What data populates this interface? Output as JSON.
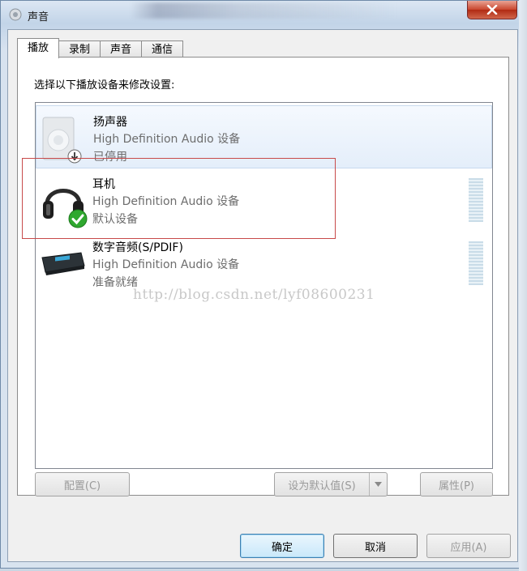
{
  "window": {
    "title": "声音"
  },
  "tabs": [
    {
      "label": "播放",
      "active": true
    },
    {
      "label": "录制",
      "active": false
    },
    {
      "label": "声音",
      "active": false
    },
    {
      "label": "通信",
      "active": false
    }
  ],
  "playback": {
    "instruction": "选择以下播放设备来修改设置:",
    "devices": [
      {
        "name": "扬声器",
        "desc": "High Definition Audio 设备",
        "status": "已停用",
        "icon": "speaker-icon",
        "badge": "disabled-arrow-icon"
      },
      {
        "name": "耳机",
        "desc": "High Definition Audio 设备",
        "status": "默认设备",
        "icon": "headphones-icon",
        "badge": "default-check-icon"
      },
      {
        "name": "数字音频(S/PDIF)",
        "desc": "High Definition Audio 设备",
        "status": "准备就绪",
        "icon": "digital-audio-icon"
      }
    ]
  },
  "watermark": "http://blog.csdn.net/lyf08600231",
  "buttons": {
    "configure": "配置(C)",
    "set_default": "设为默认值(S)",
    "properties": "属性(P)",
    "ok": "确定",
    "cancel": "取消",
    "apply": "应用(A)"
  },
  "colors": {
    "highlight_border": "#c84a4a",
    "default_check": "#2fa82f"
  }
}
